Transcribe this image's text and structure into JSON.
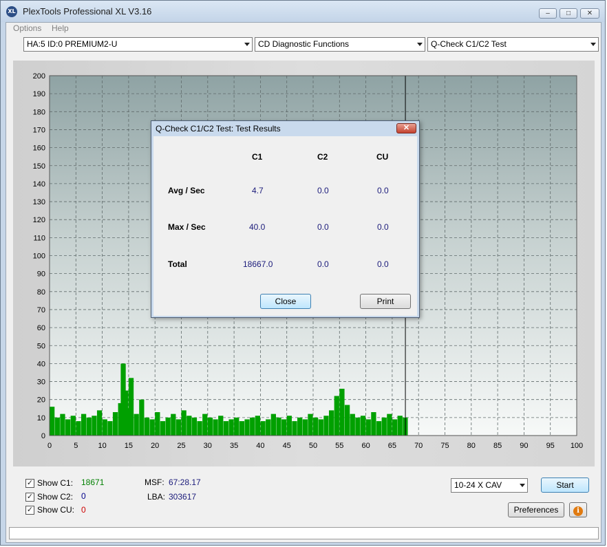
{
  "window": {
    "title": "PlexTools Professional XL V3.16",
    "app_icon": "XL",
    "controls": [
      "minimize",
      "maximize",
      "close"
    ]
  },
  "menu": {
    "items": [
      "Options",
      "Help"
    ]
  },
  "toolbar": {
    "drive": "HA:5 ID:0  PREMIUM2-U",
    "function_group": "CD Diagnostic Functions",
    "test": "Q-Check C1/C2 Test"
  },
  "chart_data": {
    "type": "bar",
    "xlim": [
      0,
      100
    ],
    "ylim": [
      0,
      200
    ],
    "x_ticks": [
      0,
      5,
      10,
      15,
      20,
      25,
      30,
      35,
      40,
      45,
      50,
      55,
      60,
      65,
      70,
      75,
      80,
      85,
      90,
      95,
      100
    ],
    "y_ticks": [
      0,
      10,
      20,
      30,
      40,
      50,
      60,
      70,
      80,
      90,
      100,
      110,
      120,
      130,
      140,
      150,
      160,
      170,
      180,
      190,
      200
    ],
    "grid": true,
    "end_marker_x": 67.5,
    "series": [
      {
        "color": "#00a000",
        "x": [
          0,
          1,
          2,
          3,
          4,
          5,
          6,
          7,
          8,
          9,
          10,
          11,
          12,
          13,
          13.5,
          14,
          14.5,
          15,
          16,
          17,
          18,
          19,
          20,
          21,
          22,
          23,
          24,
          25,
          26,
          27,
          28,
          29,
          30,
          31,
          32,
          33,
          34,
          35,
          36,
          37,
          38,
          39,
          40,
          41,
          42,
          43,
          44,
          45,
          46,
          47,
          48,
          49,
          50,
          51,
          52,
          53,
          54,
          55,
          56,
          57,
          58,
          59,
          60,
          61,
          62,
          63,
          64,
          65,
          66,
          67
        ],
        "values": [
          16,
          10,
          12,
          9,
          11,
          8,
          12,
          10,
          11,
          14,
          9,
          8,
          13,
          18,
          40,
          25,
          15,
          32,
          12,
          20,
          10,
          9,
          13,
          8,
          10,
          12,
          9,
          14,
          11,
          10,
          8,
          12,
          10,
          9,
          11,
          8,
          9,
          10,
          8,
          9,
          10,
          11,
          8,
          9,
          12,
          10,
          9,
          11,
          8,
          10,
          9,
          12,
          10,
          9,
          11,
          14,
          22,
          26,
          17,
          12,
          10,
          11,
          9,
          13,
          8,
          10,
          12,
          9,
          11,
          10
        ]
      }
    ]
  },
  "controls": {
    "show_c1": {
      "label": "Show C1:",
      "checked": true,
      "value": "18671",
      "color": "#008000"
    },
    "show_c2": {
      "label": "Show C2:",
      "checked": true,
      "value": "0",
      "color": "#00008b"
    },
    "show_cu": {
      "label": "Show CU:",
      "checked": true,
      "value": "0",
      "color": "#cc0000"
    },
    "msf_label": "MSF:",
    "msf_value": "67:28.17",
    "lba_label": "LBA:",
    "lba_value": "303617",
    "speed": "10-24 X CAV",
    "start_label": "Start",
    "preferences_label": "Preferences",
    "info_icon": "info-icon"
  },
  "dialog": {
    "title": "Q-Check C1/C2 Test: Test Results",
    "columns": [
      "C1",
      "C2",
      "CU"
    ],
    "rows": [
      {
        "label": "Avg / Sec",
        "values": [
          "4.7",
          "0.0",
          "0.0"
        ]
      },
      {
        "label": "Max / Sec",
        "values": [
          "40.0",
          "0.0",
          "0.0"
        ]
      },
      {
        "label": "Total",
        "values": [
          "18667.0",
          "0.0",
          "0.0"
        ]
      }
    ],
    "close_label": "Close",
    "print_label": "Print"
  }
}
